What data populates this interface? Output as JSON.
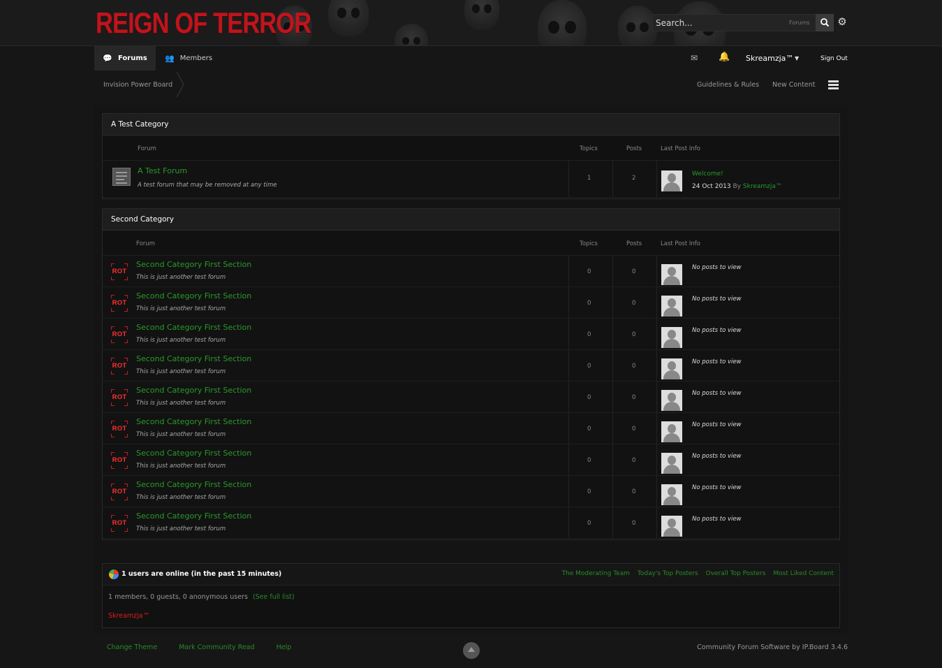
{
  "header": {
    "logo_text": "REIGN OF TERROR",
    "search": {
      "placeholder": "Search...",
      "scope": "Forums"
    },
    "settings_icon": "gear-icon"
  },
  "nav": {
    "tabs": [
      {
        "label": "Forums",
        "icon": "chat-bubble-icon",
        "active": true
      },
      {
        "label": "Members",
        "icon": "members-icon",
        "active": false
      }
    ],
    "user": {
      "name": "Skreamzja™",
      "sign_out": "Sign Out",
      "mail_icon": "mail-icon",
      "notify_icon": "bell-icon"
    }
  },
  "breadcrumb": {
    "root": "Invision Power Board"
  },
  "toolbar": {
    "guidelines": "Guidelines & Rules",
    "new_content": "New Content"
  },
  "columns": {
    "forum": "Forum",
    "topics": "Topics",
    "posts": "Posts",
    "last_post": "Last Post Info"
  },
  "categories": [
    {
      "title": "A Test Category",
      "forums": [
        {
          "title": "A Test Forum",
          "desc": "A test forum that may be removed at any time",
          "topics": "1",
          "posts": "2",
          "last_post_title": "Welcome!",
          "last_post_date": "24 Oct 2013",
          "last_post_by": "By",
          "last_post_user": "Skreamzja™"
        }
      ]
    },
    {
      "title": "Second Category",
      "forums": [
        {
          "icon_text": "ROT",
          "title": "Second Category First Section",
          "desc": "This is just another test forum",
          "topics": "0",
          "posts": "0",
          "last_post": "No posts to view"
        },
        {
          "icon_text": "ROT",
          "title": "Second Category First Section",
          "desc": "This is just another test forum",
          "topics": "0",
          "posts": "0",
          "last_post": "No posts to view"
        },
        {
          "icon_text": "ROT",
          "title": "Second Category First Section",
          "desc": "This is just another test forum",
          "topics": "0",
          "posts": "0",
          "last_post": "No posts to view"
        },
        {
          "icon_text": "ROT",
          "title": "Second Category First Section",
          "desc": "This is just another test forum",
          "topics": "0",
          "posts": "0",
          "last_post": "No posts to view"
        },
        {
          "icon_text": "ROT",
          "title": "Second Category First Section",
          "desc": "This is just another test forum",
          "topics": "0",
          "posts": "0",
          "last_post": "No posts to view"
        },
        {
          "icon_text": "ROT",
          "title": "Second Category First Section",
          "desc": "This is just another test forum",
          "topics": "0",
          "posts": "0",
          "last_post": "No posts to view"
        },
        {
          "icon_text": "ROT",
          "title": "Second Category First Section",
          "desc": "This is just another test forum",
          "topics": "0",
          "posts": "0",
          "last_post": "No posts to view"
        },
        {
          "icon_text": "ROT",
          "title": "Second Category First Section",
          "desc": "This is just another test forum",
          "topics": "0",
          "posts": "0",
          "last_post": "No posts to view"
        },
        {
          "icon_text": "ROT",
          "title": "Second Category First Section",
          "desc": "This is just another test forum",
          "topics": "0",
          "posts": "0",
          "last_post": "No posts to view"
        }
      ]
    }
  ],
  "stats": {
    "title": "1 users are online (in the past 15 minutes)",
    "links": [
      "The Moderating Team",
      "Today's Top Posters",
      "Overall Top Posters",
      "Most Liked Content"
    ],
    "summary": "1 members, 0 guests, 0 anonymous users",
    "full_list": "(See full list)",
    "online_user": "Skreamzja™"
  },
  "footer": {
    "links": [
      "Change Theme",
      "Mark Community Read",
      "Help"
    ],
    "copyright": "Community Forum Software by IP.Board 3.4.6"
  },
  "colors": {
    "brand_red": "#c0141c",
    "link_green": "#2a9a2a",
    "background": "#161616"
  }
}
